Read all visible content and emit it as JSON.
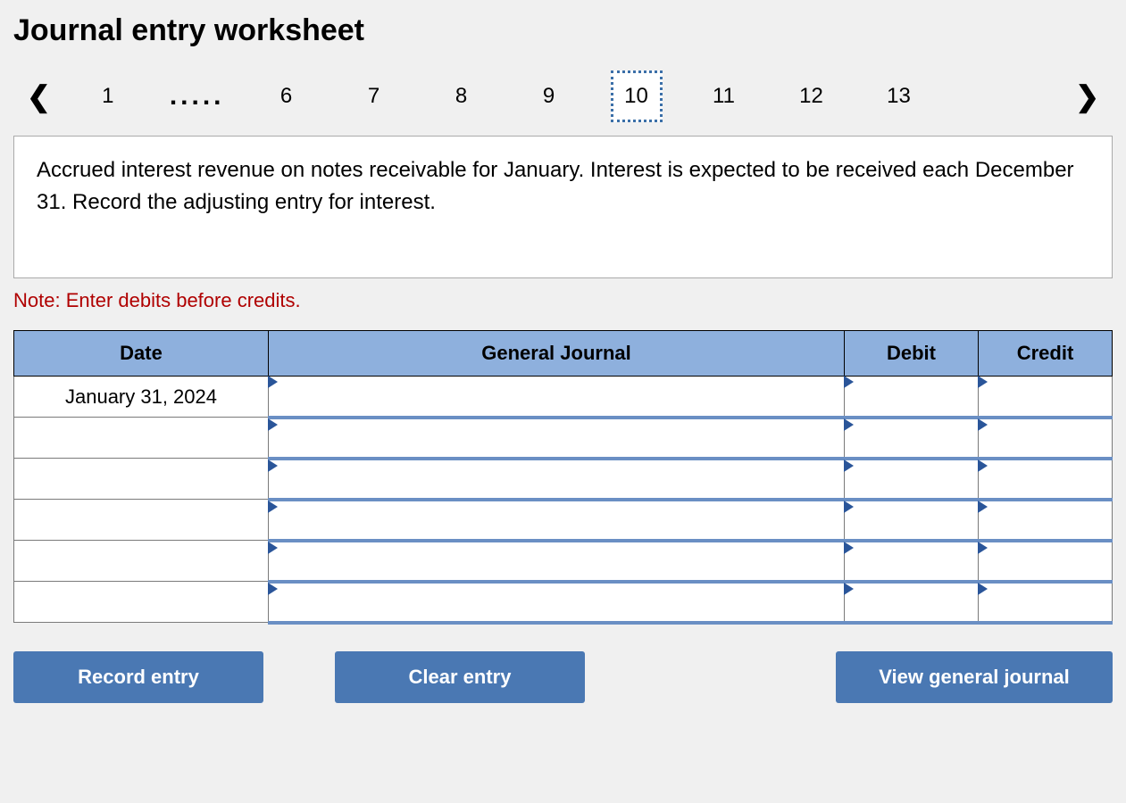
{
  "title": "Journal entry worksheet",
  "pagination": {
    "pages": [
      "1",
      ".....",
      "6",
      "7",
      "8",
      "9",
      "10",
      "11",
      "12",
      "13"
    ],
    "active": "10"
  },
  "instruction": "Accrued interest revenue on notes receivable for January. Interest is expected to be received each December 31. Record the adjusting entry for interest.",
  "note": "Note: Enter debits before credits.",
  "table": {
    "headers": {
      "date": "Date",
      "general_journal": "General Journal",
      "debit": "Debit",
      "credit": "Credit"
    },
    "rows": [
      {
        "date": "January 31, 2024",
        "gj": "",
        "debit": "",
        "credit": ""
      },
      {
        "date": "",
        "gj": "",
        "debit": "",
        "credit": ""
      },
      {
        "date": "",
        "gj": "",
        "debit": "",
        "credit": ""
      },
      {
        "date": "",
        "gj": "",
        "debit": "",
        "credit": ""
      },
      {
        "date": "",
        "gj": "",
        "debit": "",
        "credit": ""
      },
      {
        "date": "",
        "gj": "",
        "debit": "",
        "credit": ""
      }
    ]
  },
  "buttons": {
    "record": "Record entry",
    "clear": "Clear entry",
    "view": "View general journal"
  }
}
